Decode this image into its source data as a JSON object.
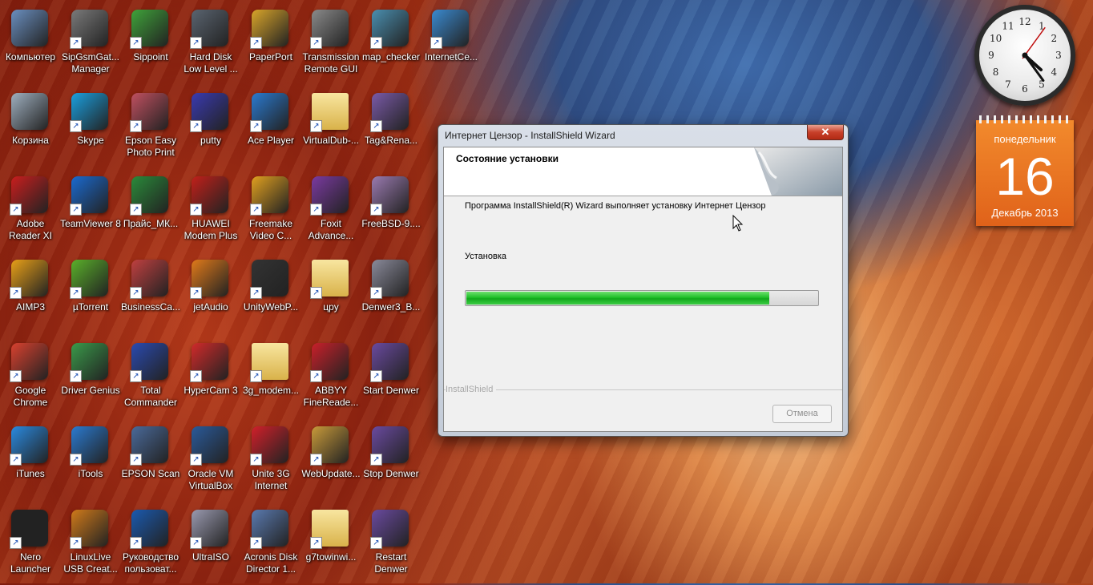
{
  "desktop_icons": [
    {
      "label": "Компьютер",
      "icon": "computer-icon",
      "color": "#6a8fc0"
    },
    {
      "label": "SipGsmGat... Manager",
      "icon": "sipgsm-icon",
      "color": "#7a7a7a"
    },
    {
      "label": "Sippoint",
      "icon": "sippoint-icon",
      "color": "#3fa33a"
    },
    {
      "label": "Hard Disk Low Level ...",
      "icon": "hdd-icon",
      "color": "#5a6470"
    },
    {
      "label": "PaperPort",
      "icon": "paperport-icon",
      "color": "#d9a52a"
    },
    {
      "label": "Transmission Remote GUI",
      "icon": "transmission-icon",
      "color": "#8a8a8a"
    },
    {
      "label": "map_checker",
      "icon": "map-checker-icon",
      "color": "#4a8fb0"
    },
    {
      "label": "InternetCe...",
      "icon": "internet-censor-icon",
      "color": "#3a8ad0"
    },
    {
      "label": "Корзина",
      "icon": "recycle-bin-icon",
      "color": "#9fb0c0"
    },
    {
      "label": "Skype",
      "icon": "skype-icon",
      "color": "#1aa0e0"
    },
    {
      "label": "Epson Easy Photo Print",
      "icon": "epson-photo-icon",
      "color": "#c05060"
    },
    {
      "label": "putty",
      "icon": "putty-icon",
      "color": "#3a3ab0"
    },
    {
      "label": "Ace Player",
      "icon": "ace-player-icon",
      "color": "#2a7ad0"
    },
    {
      "label": "VirtualDub-...",
      "icon": "folder-icon",
      "color": "#e9c86a"
    },
    {
      "label": "Tag&Rena...",
      "icon": "tag-rename-icon",
      "color": "#7a5aa8"
    },
    {
      "label": "Adobe Reader XI",
      "icon": "adobe-reader-icon",
      "color": "#c81e1e"
    },
    {
      "label": "TeamViewer 8",
      "icon": "teamviewer-icon",
      "color": "#1a6ad0"
    },
    {
      "label": "Прайс_МК...",
      "icon": "excel-file-icon",
      "color": "#2a8a3a"
    },
    {
      "label": "HUAWEI Modem Plus",
      "icon": "huawei-icon",
      "color": "#c0201a"
    },
    {
      "label": "Freemake Video C...",
      "icon": "freemake-icon",
      "color": "#e0a020"
    },
    {
      "label": "Foxit Advance...",
      "icon": "foxit-icon",
      "color": "#7a3aa0"
    },
    {
      "label": "FreeBSD-9....",
      "icon": "disc-image-icon",
      "color": "#9a7ab0"
    },
    {
      "label": "AIMP3",
      "icon": "aimp-icon",
      "color": "#e8a018"
    },
    {
      "label": "µTorrent",
      "icon": "utorrent-icon",
      "color": "#5ab02a"
    },
    {
      "label": "BusinessCa...",
      "icon": "businesscard-icon",
      "color": "#c04040"
    },
    {
      "label": "jetAudio",
      "icon": "jetaudio-icon",
      "color": "#e07a1a"
    },
    {
      "label": "UnityWebP...",
      "icon": "unity-icon",
      "color": "#333333"
    },
    {
      "label": "цру",
      "icon": "folder-icon",
      "color": "#e9c86a"
    },
    {
      "label": "Denwer3_B...",
      "icon": "denwer-icon",
      "color": "#8a8a9a"
    },
    {
      "label": "Google Chrome",
      "icon": "chrome-icon",
      "color": "#d9412f"
    },
    {
      "label": "Driver Genius",
      "icon": "driver-genius-icon",
      "color": "#3a9a4a"
    },
    {
      "label": "Total Commander",
      "icon": "total-commander-icon",
      "color": "#2a4ab0"
    },
    {
      "label": "HyperCam 3",
      "icon": "hypercam-icon",
      "color": "#d02a2a"
    },
    {
      "label": "3g_modem...",
      "icon": "folder-icon",
      "color": "#e9c86a"
    },
    {
      "label": "ABBYY FineReade...",
      "icon": "abbyy-icon",
      "color": "#c8202a"
    },
    {
      "label": "Start Denwer",
      "icon": "start-denwer-icon",
      "color": "#6a4aa0"
    },
    {
      "label": "iTunes",
      "icon": "itunes-icon",
      "color": "#2a8ae0"
    },
    {
      "label": "iTools",
      "icon": "itools-icon",
      "color": "#2a7ad0"
    },
    {
      "label": "EPSON Scan",
      "icon": "epson-scan-icon",
      "color": "#4a6a9a"
    },
    {
      "label": "Oracle VM VirtualBox",
      "icon": "virtualbox-icon",
      "color": "#2a5a9a"
    },
    {
      "label": "Unite 3G Internet",
      "icon": "unite-3g-icon",
      "color": "#d0202a"
    },
    {
      "label": "WebUpdate...",
      "icon": "webupdate-icon",
      "color": "#c89a3a"
    },
    {
      "label": "Stop Denwer",
      "icon": "stop-denwer-icon",
      "color": "#6a4aa0"
    },
    {
      "label": "Nero Launcher",
      "icon": "nero-icon",
      "color": "#222222"
    },
    {
      "label": "LinuxLive USB Creat...",
      "icon": "linuxlive-icon",
      "color": "#d07a1a"
    },
    {
      "label": "Руководство пользоват...",
      "icon": "manual-icon",
      "color": "#1a5ab0"
    },
    {
      "label": "UltraISO",
      "icon": "ultraiso-icon",
      "color": "#9a9ab0"
    },
    {
      "label": "Acronis Disk Director 1...",
      "icon": "acronis-icon",
      "color": "#5a7ab0"
    },
    {
      "label": "g7towinwi...",
      "icon": "folder-icon",
      "color": "#e9c86a"
    },
    {
      "label": "Restart Denwer",
      "icon": "restart-denwer-icon",
      "color": "#6a4aa0"
    }
  ],
  "clock": {
    "hour": 4,
    "minute": 24,
    "second": 6
  },
  "calendar": {
    "weekday": "понедельник",
    "day": "16",
    "month_year": "Декабрь 2013"
  },
  "dialog": {
    "title": "Интернет Цензор - InstallShield Wizard",
    "close_glyph": "✕",
    "header_title": "Состояние установки",
    "description": "Программа InstallShield(R) Wizard выполняет установку Интернет Цензор",
    "status_label": "Установка",
    "progress_percent": 86,
    "brand": "InstallShield",
    "cancel_label": "Отмена"
  }
}
